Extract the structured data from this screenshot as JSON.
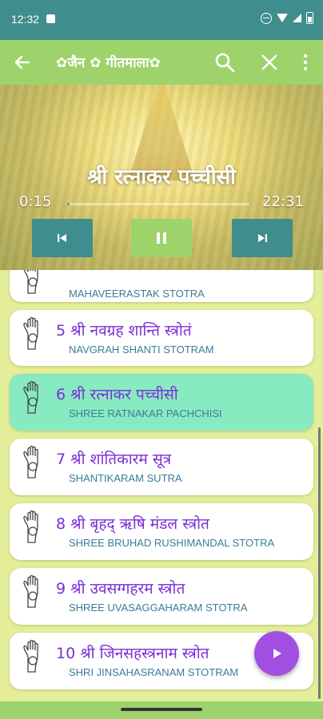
{
  "status": {
    "time": "12:32"
  },
  "appbar": {
    "title": "✿जैन ✿ गीतमाला✿"
  },
  "player": {
    "song_title": "श्री रत्नाकर पच्चीसी",
    "current_time": "0:15",
    "total_time": "22:31",
    "progress": 0.011
  },
  "list": {
    "items": [
      {
        "hindi": "",
        "english": "MAHAVEERASTAK STOTRA"
      },
      {
        "hindi": "5 श्री नवग्रह शान्ति स्त्रोतं",
        "english": "NAVGRAH SHANTI STOTRAM"
      },
      {
        "hindi": "6 श्री रत्नाकर पच्चीसी",
        "english": "SHREE RATNAKAR PACHCHISI"
      },
      {
        "hindi": "7 श्री शांतिकारम सूत्र",
        "english": "SHANTIKARAM SUTRA"
      },
      {
        "hindi": "8 श्री बृहद् ऋषि मंडल स्त्रोत",
        "english": "SHREE BRUHAD RUSHIMANDAL STOTRA"
      },
      {
        "hindi": "9 श्री उवसग्गहरम स्त्रोत",
        "english": "SHREE UVASAGGAHARAM STOTRA"
      },
      {
        "hindi": "10 श्री जिनसहस्त्रनाम स्त्रोत",
        "english": "SHRI JINSAHASRANAM STOTRAM"
      }
    ]
  },
  "colors": {
    "primary": "#3f8d8d",
    "accent_green": "#9ed36b",
    "active_item": "#88eac0",
    "hindi_text": "#7a2fd6",
    "english_text": "#3b7c98",
    "fab": "#a14fe0"
  }
}
